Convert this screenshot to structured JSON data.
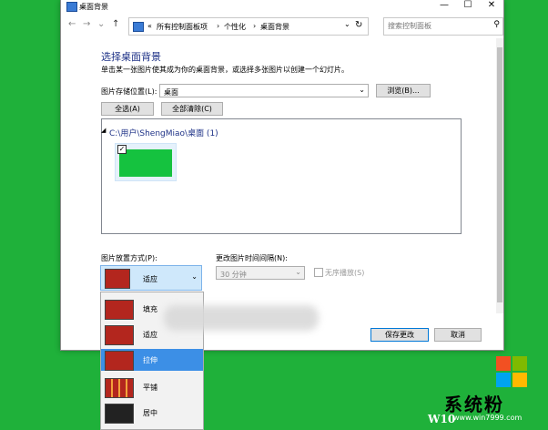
{
  "window": {
    "title": "桌面背景",
    "minimize": "—",
    "maximize": "☐",
    "close": "✕"
  },
  "address": {
    "back": "←",
    "forward": "→",
    "recent": "⌄",
    "up": "↑",
    "crumbs": [
      "«",
      "所有控制面板项",
      "›",
      "个性化",
      "›",
      "桌面背景"
    ],
    "dropdown": "⌄",
    "refresh": "↻",
    "search_placeholder": "搜索控制面板"
  },
  "page": {
    "heading": "选择桌面背景",
    "subtext": "单击某一张图片使其成为你的桌面背景，或选择多张图片以创建一个幻灯片。",
    "location_label": "图片存储位置(L):",
    "location_value": "桌面",
    "browse": "浏览(B)...",
    "select_all": "全选(A)",
    "clear_all": "全部清除(C)",
    "folder": "C:\\用户\\ShengMiao\\桌面 (1)",
    "check_mark": "✓",
    "position_label": "图片放置方式(P):",
    "position_value": "适应",
    "interval_label": "更改图片时间间隔(N):",
    "interval_value": "30 分钟",
    "shuffle_label": "无序播放(S)",
    "save": "保存更改",
    "cancel": "取消"
  },
  "dropdown_items": [
    {
      "label": "填充"
    },
    {
      "label": "适应"
    },
    {
      "label": "拉伸",
      "selected": true
    },
    {
      "label": "平铺"
    },
    {
      "label": "居中"
    }
  ],
  "watermark": {
    "brand": "系统粉",
    "site": "www.win7999.com",
    "w10": "W10"
  },
  "colors": {
    "accent": "#0078d7",
    "background": "#1fb13a",
    "selected": "#3c8fe6",
    "link_heading": "#1e3287"
  }
}
